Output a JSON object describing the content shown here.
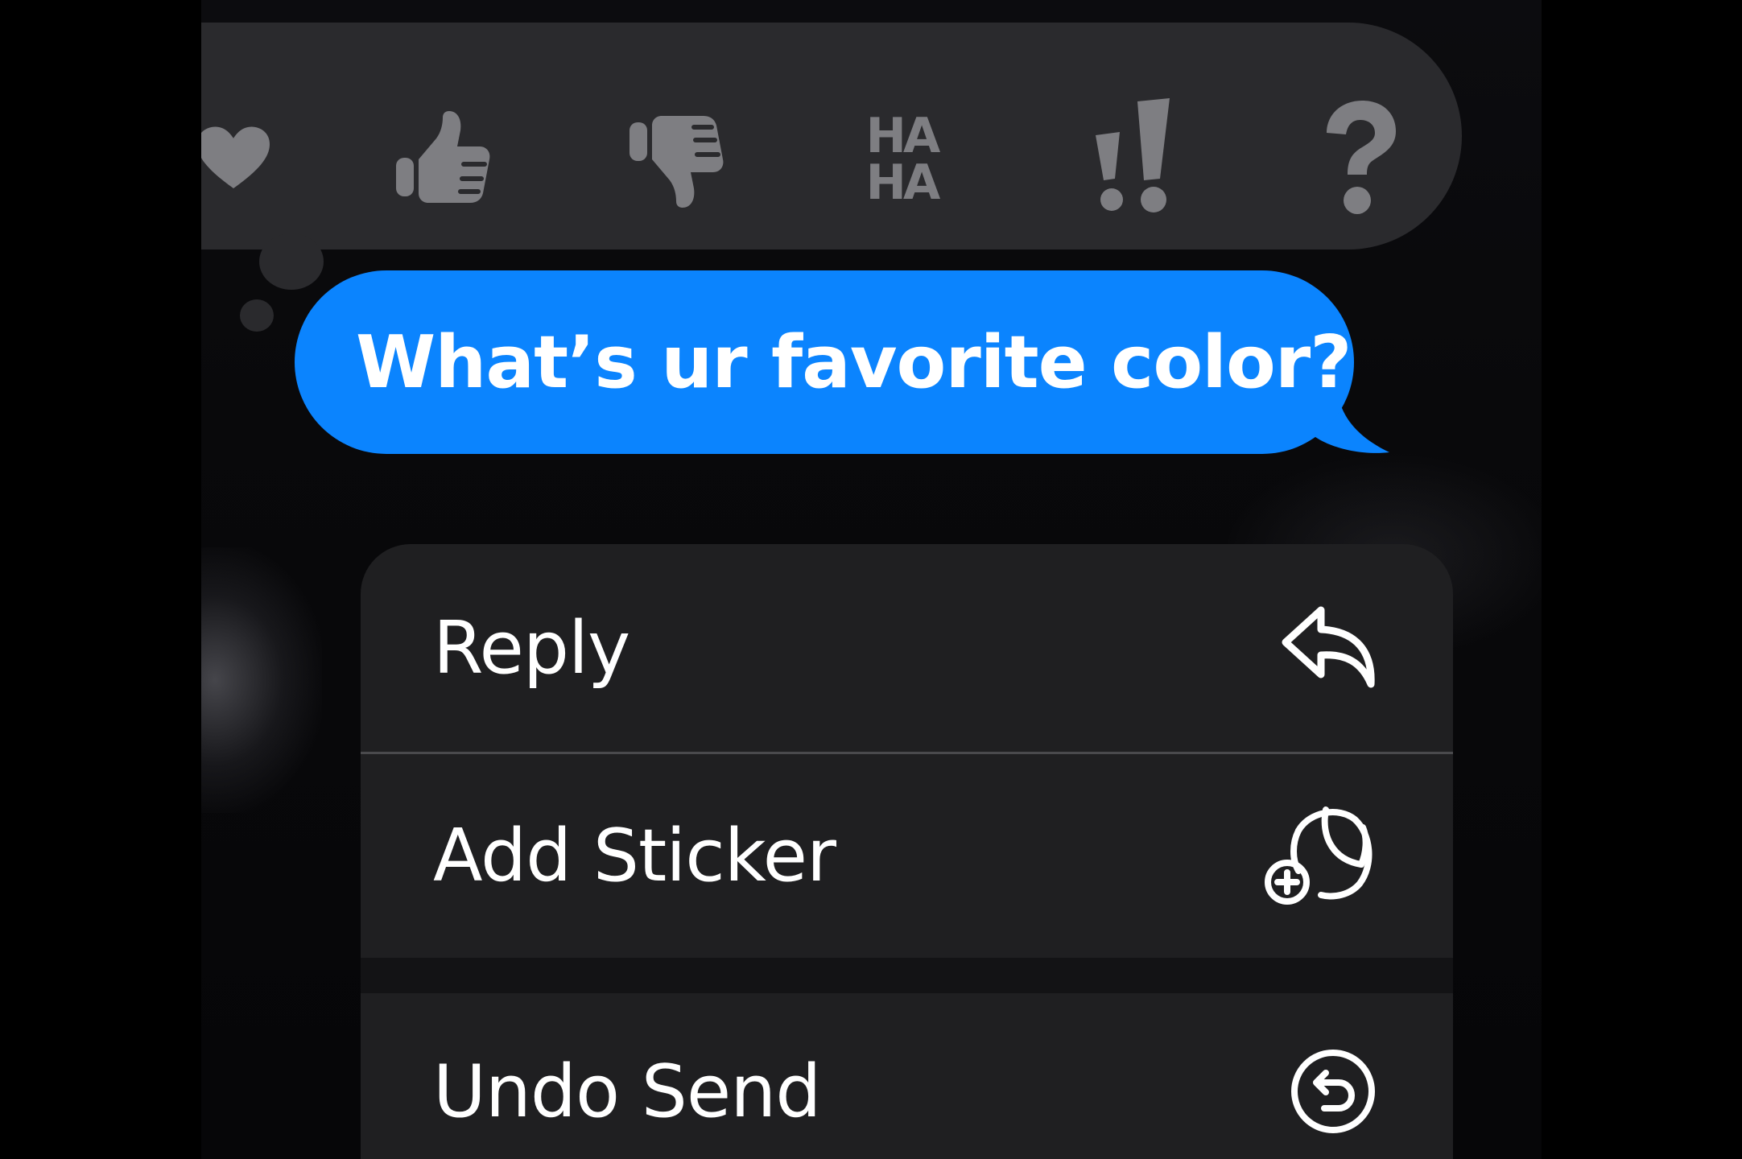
{
  "tapbacks": [
    {
      "name": "heart",
      "icon": "heart-icon"
    },
    {
      "name": "thumbs-up",
      "icon": "thumbs-up-icon"
    },
    {
      "name": "thumbs-down",
      "icon": "thumbs-down-icon"
    },
    {
      "name": "haha",
      "icon": "haha-icon",
      "line1": "HA",
      "line2": "HA"
    },
    {
      "name": "emphasize",
      "icon": "double-exclamation-icon"
    },
    {
      "name": "question",
      "icon": "question-mark-icon"
    }
  ],
  "message": {
    "text": "What’s ur favorite color?",
    "bubble_color": "#0b84fe"
  },
  "menu": {
    "items": [
      {
        "label": "Reply",
        "icon": "reply-arrow-icon"
      },
      {
        "label": "Add Sticker",
        "icon": "add-sticker-icon"
      },
      {
        "label": "Undo Send",
        "icon": "undo-send-icon"
      }
    ]
  },
  "colors": {
    "background": "#000000",
    "tapback_bar": "#2a2a2d",
    "tapback_icon": "#7e7e82",
    "menu_background": "#1f1f21",
    "text": "#ffffff"
  }
}
